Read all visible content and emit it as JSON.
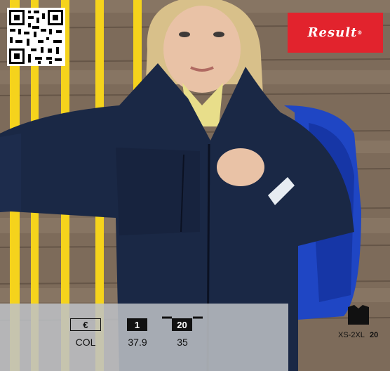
{
  "brand": {
    "name": "Result",
    "mark": "®"
  },
  "product_info": {
    "price": {
      "currency_symbol": "€",
      "code": "COL"
    },
    "pack": {
      "quantity": "1",
      "value": "37.9"
    },
    "carton": {
      "quantity": "20",
      "value": "35"
    }
  },
  "sizes": {
    "range": "XS-2XL",
    "count": "20"
  },
  "icons": {
    "qr": "qr-code-icon",
    "garment": "jacket-size-icon"
  },
  "colors": {
    "brand_red": "#e2232d",
    "jacket_navy": "#1a2845",
    "bag_blue": "#1f46c4",
    "pole_yellow": "#f5d31c"
  }
}
